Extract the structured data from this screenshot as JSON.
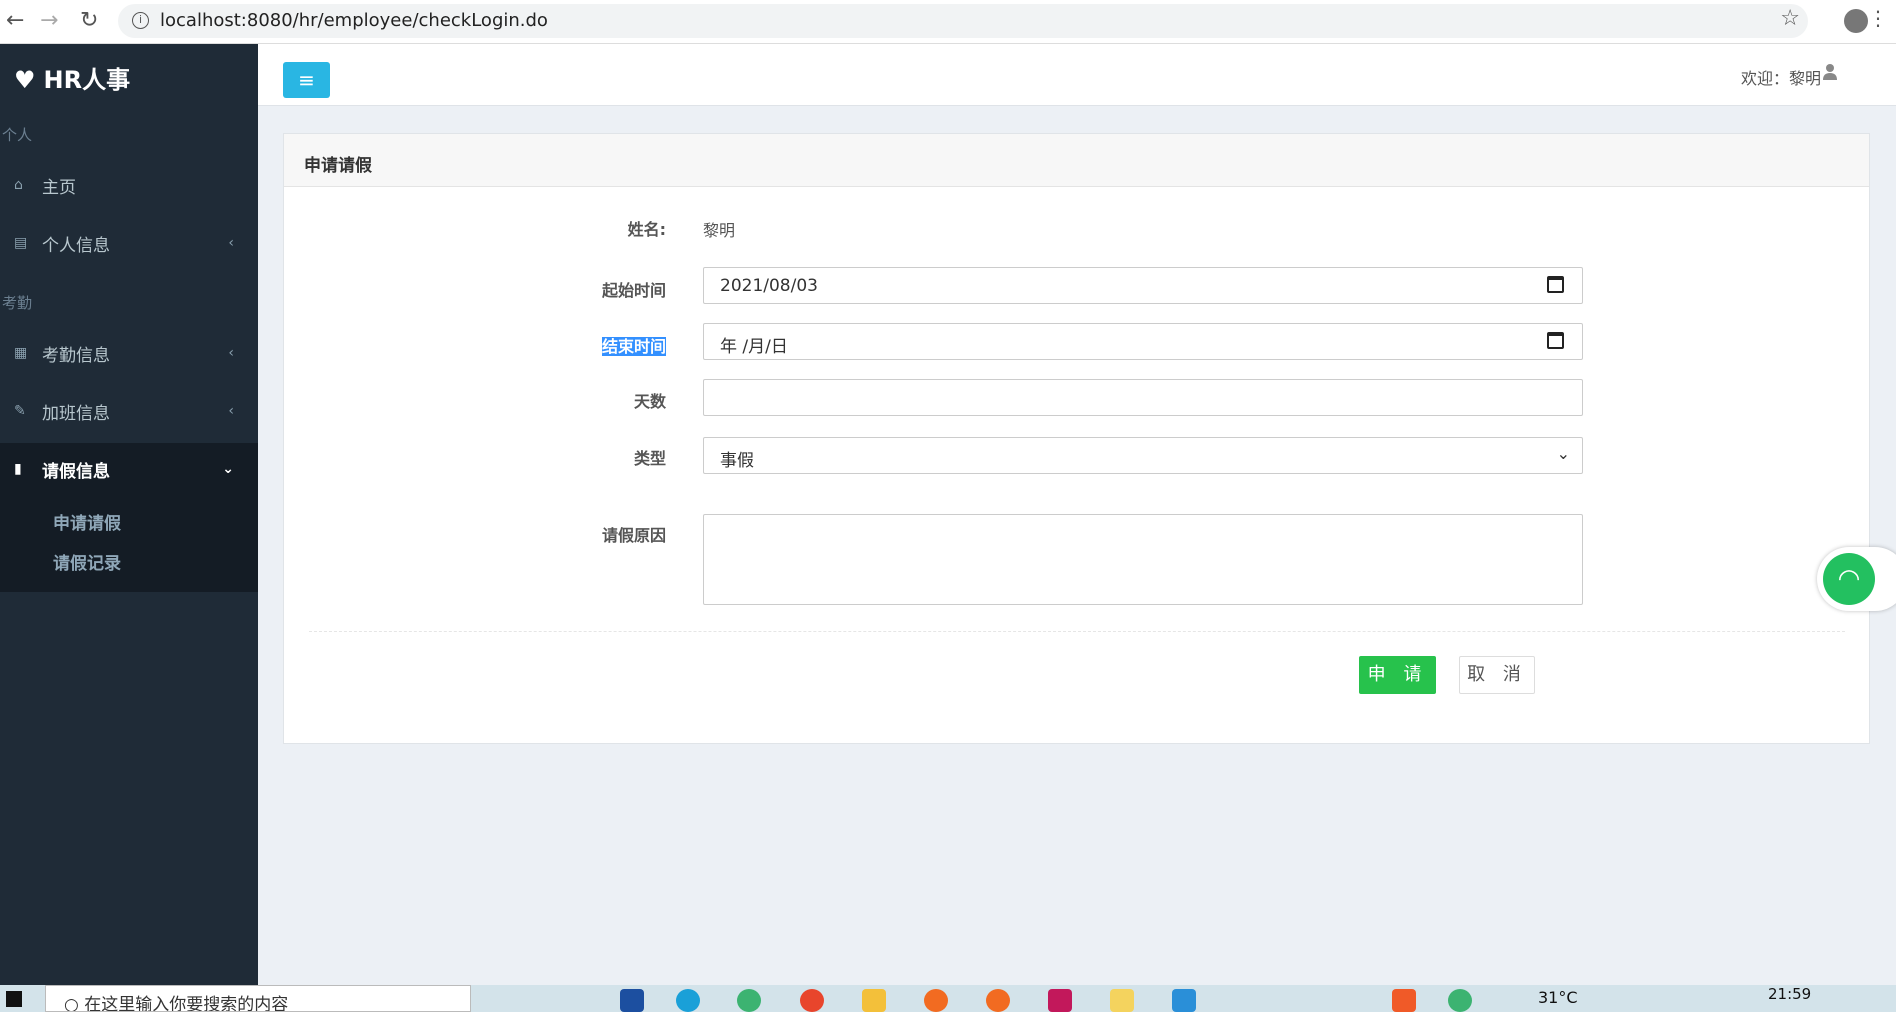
{
  "browser": {
    "url": "localhost:8080/hr/employee/checkLogin.do"
  },
  "sidebar": {
    "logo": "HR人事",
    "section_personal": "个人",
    "section_attendance": "考勤",
    "items": [
      {
        "label": "主页"
      },
      {
        "label": "个人信息"
      },
      {
        "label": "考勤信息"
      },
      {
        "label": "加班信息"
      },
      {
        "label": "请假信息"
      }
    ],
    "sub_items": [
      {
        "label": "申请请假"
      },
      {
        "label": "请假记录"
      }
    ]
  },
  "header": {
    "welcome": "欢迎：黎明"
  },
  "card": {
    "title": "申请请假",
    "name_label": "姓名:",
    "name_value": "黎明",
    "start_label": "起始时间",
    "start_value": "2021/08/03",
    "end_label": "结束时间",
    "end_placeholder": "年 /月/日",
    "days_label": "天数",
    "days_value": "",
    "type_label": "类型",
    "type_value": "事假",
    "reason_label": "请假原因",
    "submit": "申 请",
    "cancel": "取 消"
  },
  "taskbar": {
    "search_placeholder": "在这里输入你要搜索的内容",
    "temperature": "31°C",
    "time": "21:59"
  },
  "colors": {
    "sidebar": "#1f2b37",
    "accent": "#29b6e3",
    "submit": "#27c24c"
  }
}
